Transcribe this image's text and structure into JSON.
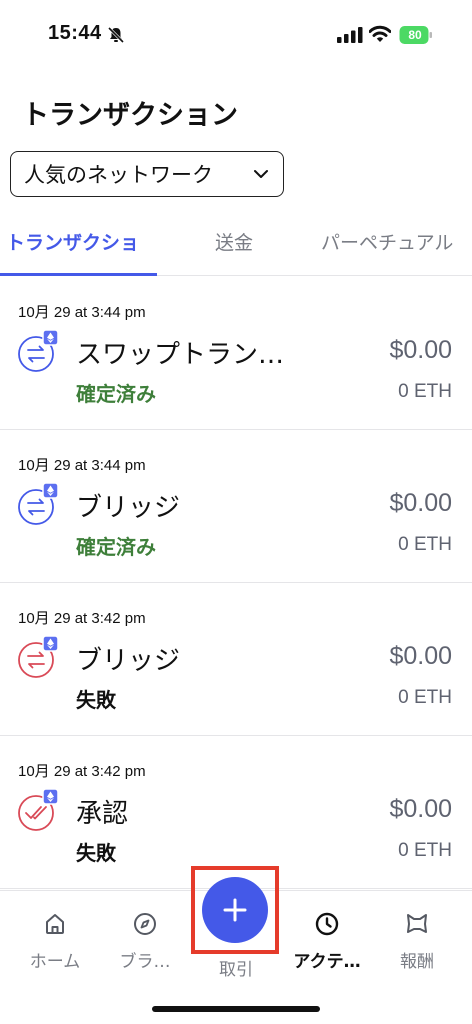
{
  "status_bar": {
    "time": "15:44",
    "battery": "80"
  },
  "page": {
    "title": "トランザクション"
  },
  "network_filter": {
    "label": "人気のネットワーク"
  },
  "tabs": [
    {
      "label": "トランザクショ",
      "active": true
    },
    {
      "label": "送金",
      "active": false
    },
    {
      "label": "パーペチュアル",
      "active": false
    }
  ],
  "transactions": [
    {
      "date": "10月 29 at 3:44 pm",
      "name": "スワップトラン…",
      "status": "確定済み",
      "amount": "$0.00",
      "eth": "0 ETH",
      "icon": "swap-icon",
      "state": "ok"
    },
    {
      "date": "10月 29 at 3:44 pm",
      "name": "ブリッジ",
      "status": "確定済み",
      "amount": "$0.00",
      "eth": "0 ETH",
      "icon": "bridge-icon",
      "state": "ok"
    },
    {
      "date": "10月 29 at 3:42 pm",
      "name": "ブリッジ",
      "status": "失敗",
      "amount": "$0.00",
      "eth": "0 ETH",
      "icon": "bridge-icon",
      "state": "failed"
    },
    {
      "date": "10月 29 at 3:42 pm",
      "name": "承認",
      "status": "失敗",
      "amount": "$0.00",
      "eth": "0 ETH",
      "icon": "approve-icon",
      "state": "failed"
    }
  ],
  "bottom_nav": {
    "home": "ホーム",
    "browser": "ブラ…",
    "trade": "取引",
    "activity": "アクテ…",
    "rewards": "報酬"
  },
  "colors": {
    "accent": "#4459e8",
    "success": "#3e7f3a",
    "failure_icon": "#d94a57",
    "highlight": "#e53b2b"
  }
}
